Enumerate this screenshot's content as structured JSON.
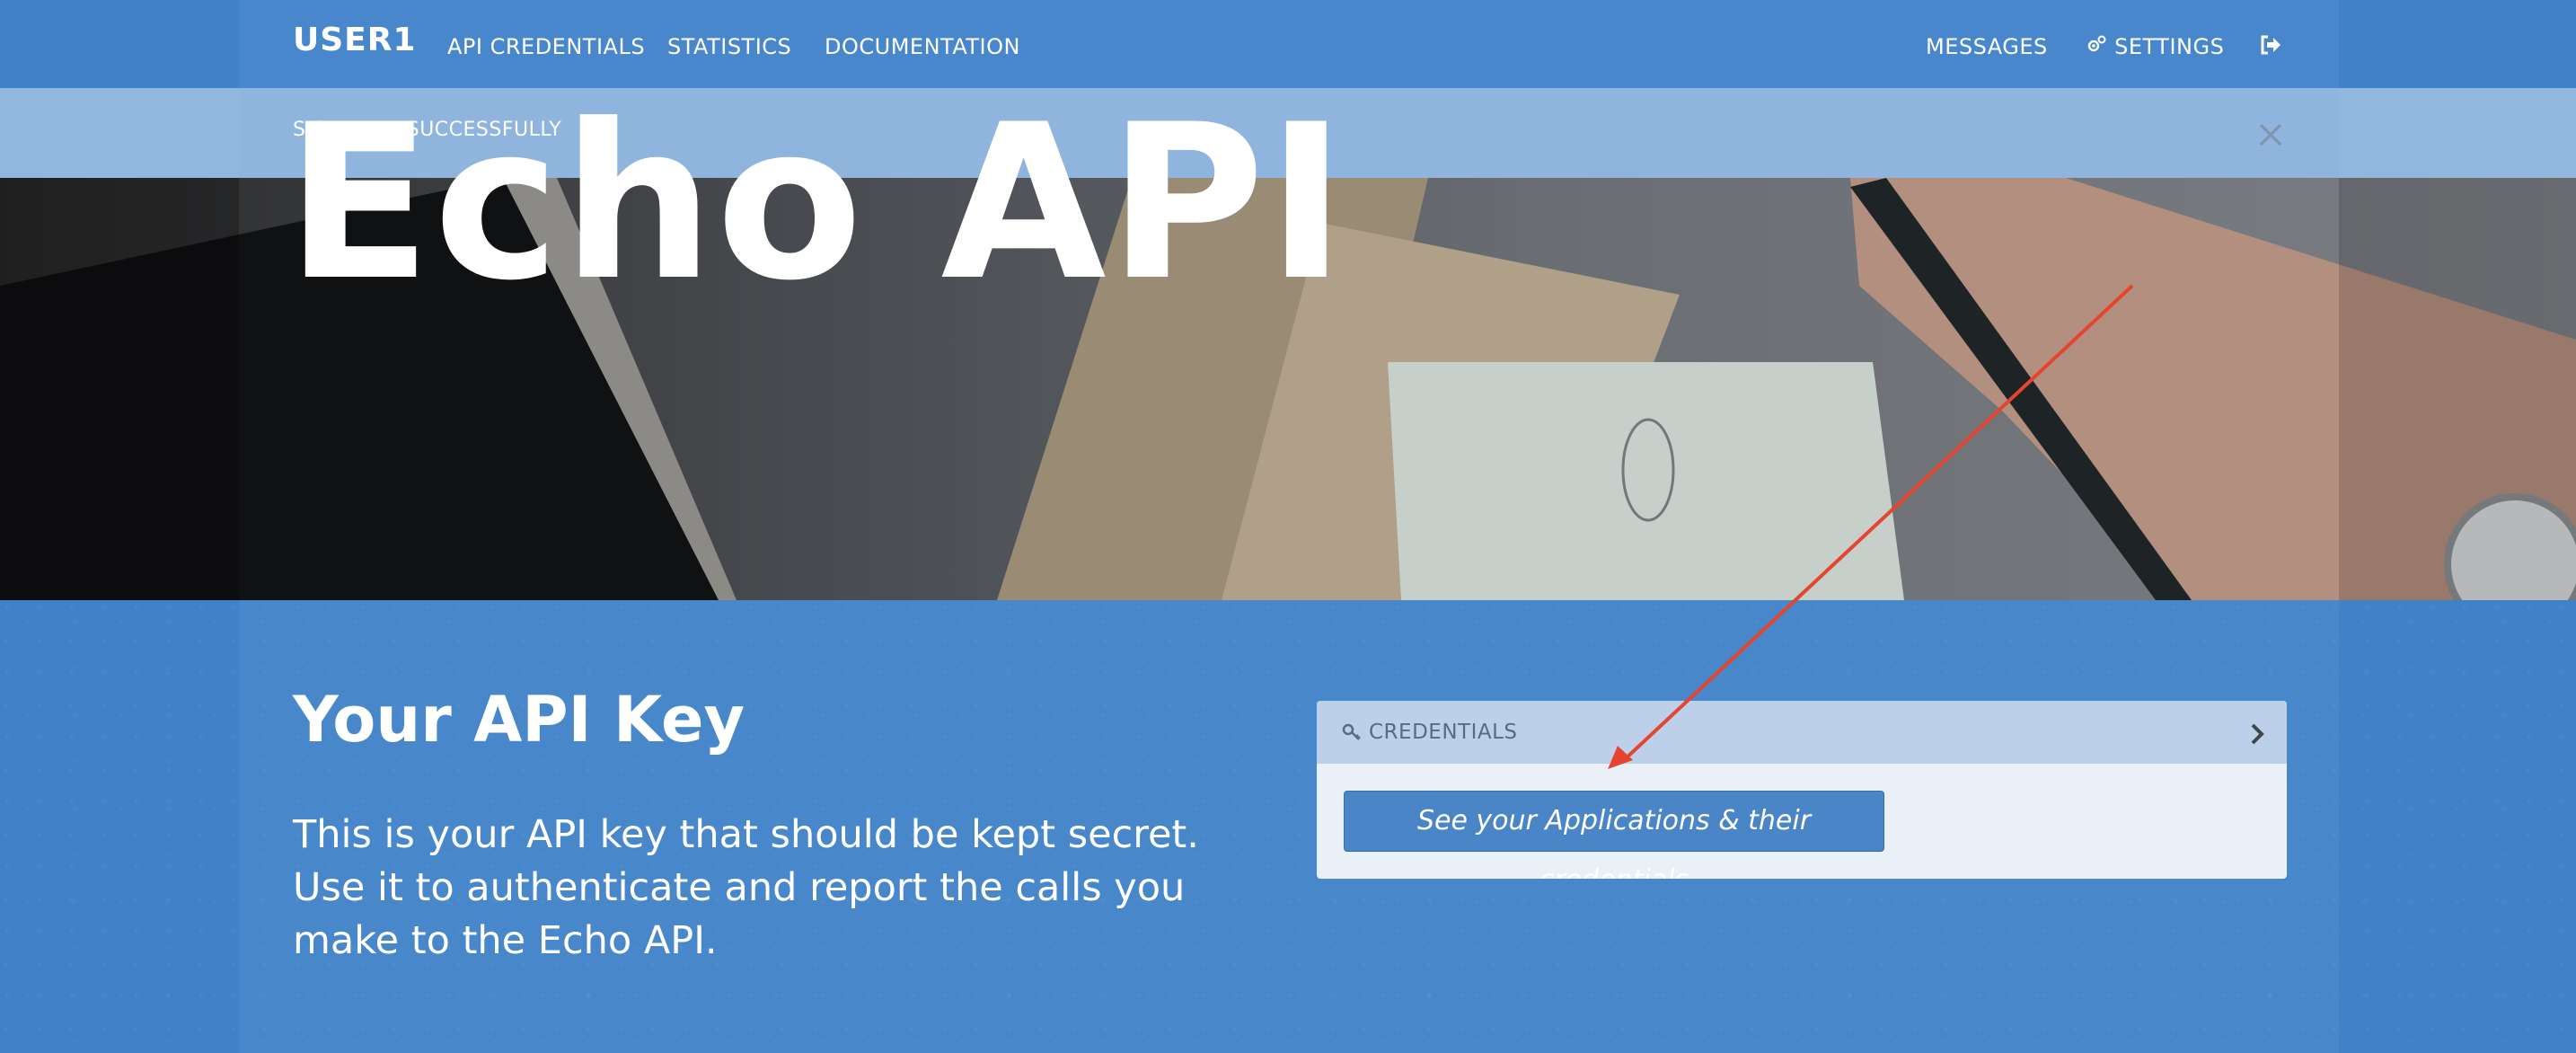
{
  "nav": {
    "brand": "USER1",
    "links": [
      "API CREDENTIALS",
      "STATISTICS",
      "DOCUMENTATION"
    ],
    "messages": "MESSAGES",
    "settings": "SETTINGS",
    "settings_icon": "gear-icon",
    "logout_icon": "sign-out-icon"
  },
  "flash": {
    "message": "SIGNED IN SUCCESSFULLY",
    "close_icon": "close-icon"
  },
  "hero": {
    "title": "Echo API"
  },
  "main": {
    "title": "Your API Key",
    "description": "This is your API key that should be kept secret. Use it to authenticate and report the calls you make to the Echo API."
  },
  "panel": {
    "header": "CREDENTIALS",
    "header_icon": "key-icon",
    "chevron_icon": "chevron-right-icon",
    "button": "See your Applications & their credentials"
  },
  "colors": {
    "background": "#3f82c8",
    "flash": "#92b7df",
    "panel": "#e9f0f8",
    "panel_header": "#bcd1e9",
    "button": "#4a86c7",
    "annotation_arrow": "#e5452f"
  }
}
